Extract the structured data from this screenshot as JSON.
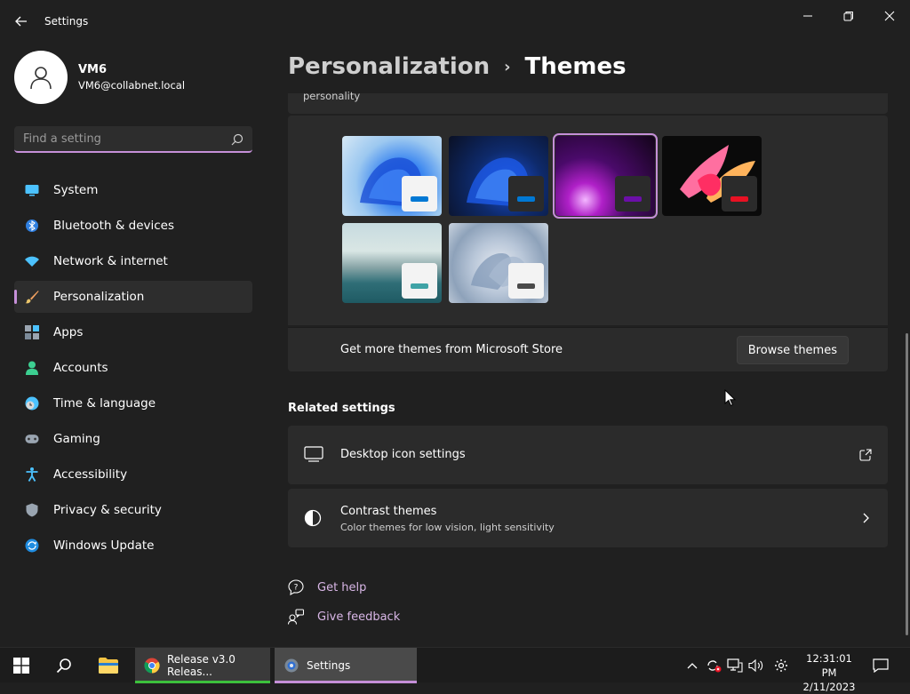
{
  "window": {
    "app_title": "Settings"
  },
  "user": {
    "name": "VM6",
    "email": "VM6@collabnet.local"
  },
  "search": {
    "placeholder": "Find a setting"
  },
  "nav": {
    "items": [
      {
        "label": "System",
        "icon": "system-icon",
        "active": false
      },
      {
        "label": "Bluetooth & devices",
        "icon": "bluetooth-icon",
        "active": false
      },
      {
        "label": "Network & internet",
        "icon": "wifi-icon",
        "active": false
      },
      {
        "label": "Personalization",
        "icon": "brush-icon",
        "active": true
      },
      {
        "label": "Apps",
        "icon": "apps-icon",
        "active": false
      },
      {
        "label": "Accounts",
        "icon": "accounts-icon",
        "active": false
      },
      {
        "label": "Time & language",
        "icon": "clock-globe-icon",
        "active": false
      },
      {
        "label": "Gaming",
        "icon": "gamepad-icon",
        "active": false
      },
      {
        "label": "Accessibility",
        "icon": "accessibility-icon",
        "active": false
      },
      {
        "label": "Privacy & security",
        "icon": "shield-icon",
        "active": false
      },
      {
        "label": "Windows Update",
        "icon": "update-icon",
        "active": false
      }
    ]
  },
  "breadcrumb": {
    "parent": "Personalization",
    "separator": "›",
    "current": "Themes"
  },
  "themes": {
    "partial_text": "personality",
    "items": [
      {
        "name": "windows-light",
        "accent": "#0078d4",
        "selected": false
      },
      {
        "name": "windows-dark",
        "accent": "#0078d4",
        "selected": false
      },
      {
        "name": "glow",
        "accent": "#6b0fa8",
        "selected": true
      },
      {
        "name": "captured-motion",
        "accent": "#e81123",
        "selected": false
      },
      {
        "name": "sunrise",
        "accent": "#3fa3a6",
        "selected": false
      },
      {
        "name": "flow",
        "accent": "#4a4a4a",
        "selected": false
      }
    ],
    "store_label": "Get more themes from Microsoft Store",
    "browse_button": "Browse themes"
  },
  "related": {
    "title": "Related settings",
    "items": [
      {
        "title": "Desktop icon settings",
        "subtitle": "",
        "icon": "monitor-icon",
        "trail": "external-link-icon"
      },
      {
        "title": "Contrast themes",
        "subtitle": "Color themes for low vision, light sensitivity",
        "icon": "contrast-icon",
        "trail": "chevron-right-icon"
      }
    ]
  },
  "help": {
    "get_help": "Get help",
    "give_feedback": "Give feedback"
  },
  "taskbar": {
    "tasks": [
      {
        "label": "Release v3.0 Releas...",
        "icon": "chrome-icon",
        "underline": "#3cc03c"
      },
      {
        "label": "Settings",
        "icon": "settings-gear-icon",
        "underline": "#c58fd8"
      }
    ],
    "time": "12:31:01 PM",
    "date": "2/11/2023"
  },
  "colors": {
    "accent": "#c58fd8",
    "background": "#202020",
    "card": "#2b2b2b"
  }
}
